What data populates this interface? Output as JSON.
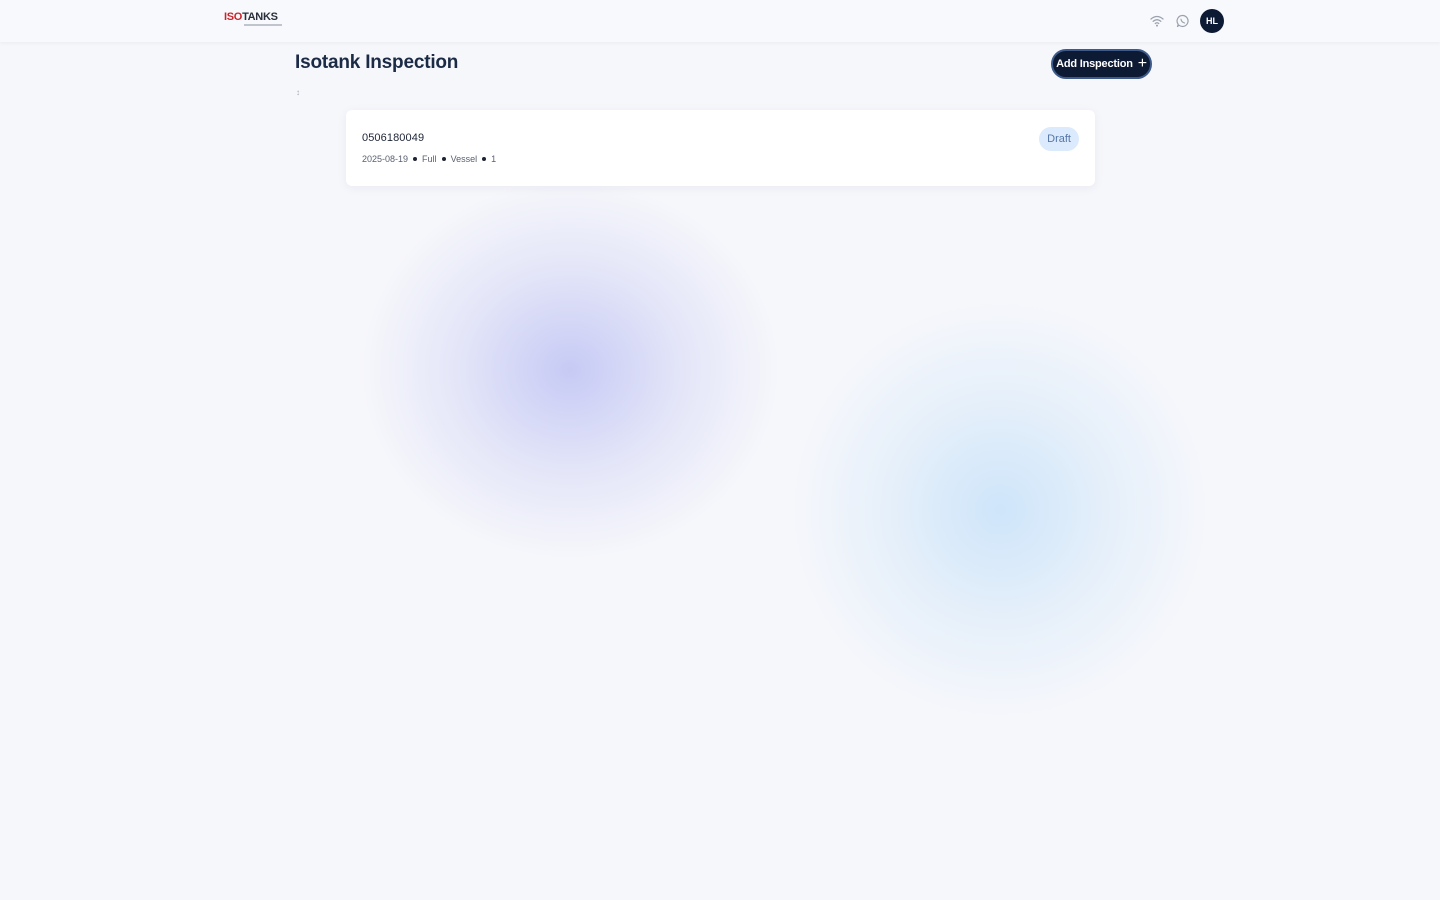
{
  "header": {
    "logo": {
      "text_part1": "ISO",
      "text_part2": "TANKS",
      "tagline": ""
    },
    "icons": [
      "wifi-icon",
      "whatsapp-icon"
    ],
    "avatar_initials": "HL"
  },
  "main": {
    "title": "Isotank Inspection",
    "add_button_label": "Add Inspection",
    "add_button_icon": "+",
    "small_glyph": "↕"
  },
  "inspections": [
    {
      "id": "0506180049",
      "date": "2025-08-19",
      "load_state": "Full",
      "status_type": "Vessel",
      "count": "1",
      "badge": "Draft"
    }
  ],
  "colors": {
    "primary_dark": "#0d1a33",
    "badge_bg": "#dbeafc",
    "badge_text": "#5577a8",
    "logo_accent": "#c8242b"
  }
}
